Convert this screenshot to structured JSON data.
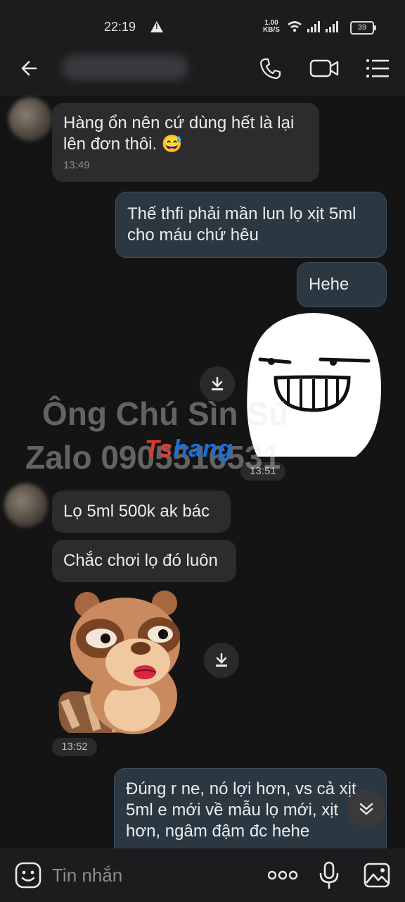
{
  "status_bar": {
    "time": "22:19",
    "speed": "1.00",
    "speed_unit": "KB/S",
    "battery": "39"
  },
  "header": {
    "back_icon": "arrow-left-icon",
    "call_icon": "phone-icon",
    "video_icon": "video-camera-icon",
    "menu_icon": "list-menu-icon"
  },
  "messages": [
    {
      "direction": "in",
      "text": "Hàng ổn nên cứ dùng hết là lại lên đơn thôi. 😅",
      "time": "13:49"
    },
    {
      "direction": "out",
      "text": "Thế thfi phải mần lun lọ xịt 5ml cho máu chứ hêu"
    },
    {
      "direction": "out",
      "text": "Hehe"
    },
    {
      "direction": "out",
      "type": "sticker",
      "sticker": "grinning-face-sticker",
      "time": "13:51"
    },
    {
      "direction": "in",
      "text": "Lọ 5ml 500k ak bác"
    },
    {
      "direction": "in",
      "text": "Chắc chơi lọ đó luôn"
    },
    {
      "direction": "in",
      "type": "sticker",
      "sticker": "raccoon-sticker",
      "time": "13:52"
    },
    {
      "direction": "out",
      "text": "Đúng r ne, nó lợi hơn, vs cả xịt 5ml e mới về mẫu lọ mới, xịt hơn, ngâm đậm đc hehe"
    }
  ],
  "watermark": {
    "line1": "Ông Chú Sìn Sú",
    "line2": "Zalo 0905516531",
    "logo_part1": "Ts",
    "logo_part2": "hang"
  },
  "input_bar": {
    "placeholder": "Tin nhắn",
    "emoji_icon": "emoji-icon",
    "more_icon": "more-dots-icon",
    "mic_icon": "microphone-icon",
    "image_icon": "image-icon"
  },
  "colors": {
    "background": "#141414",
    "incoming_bubble": "#2c2c2e",
    "outgoing_bubble": "#2b3741"
  }
}
